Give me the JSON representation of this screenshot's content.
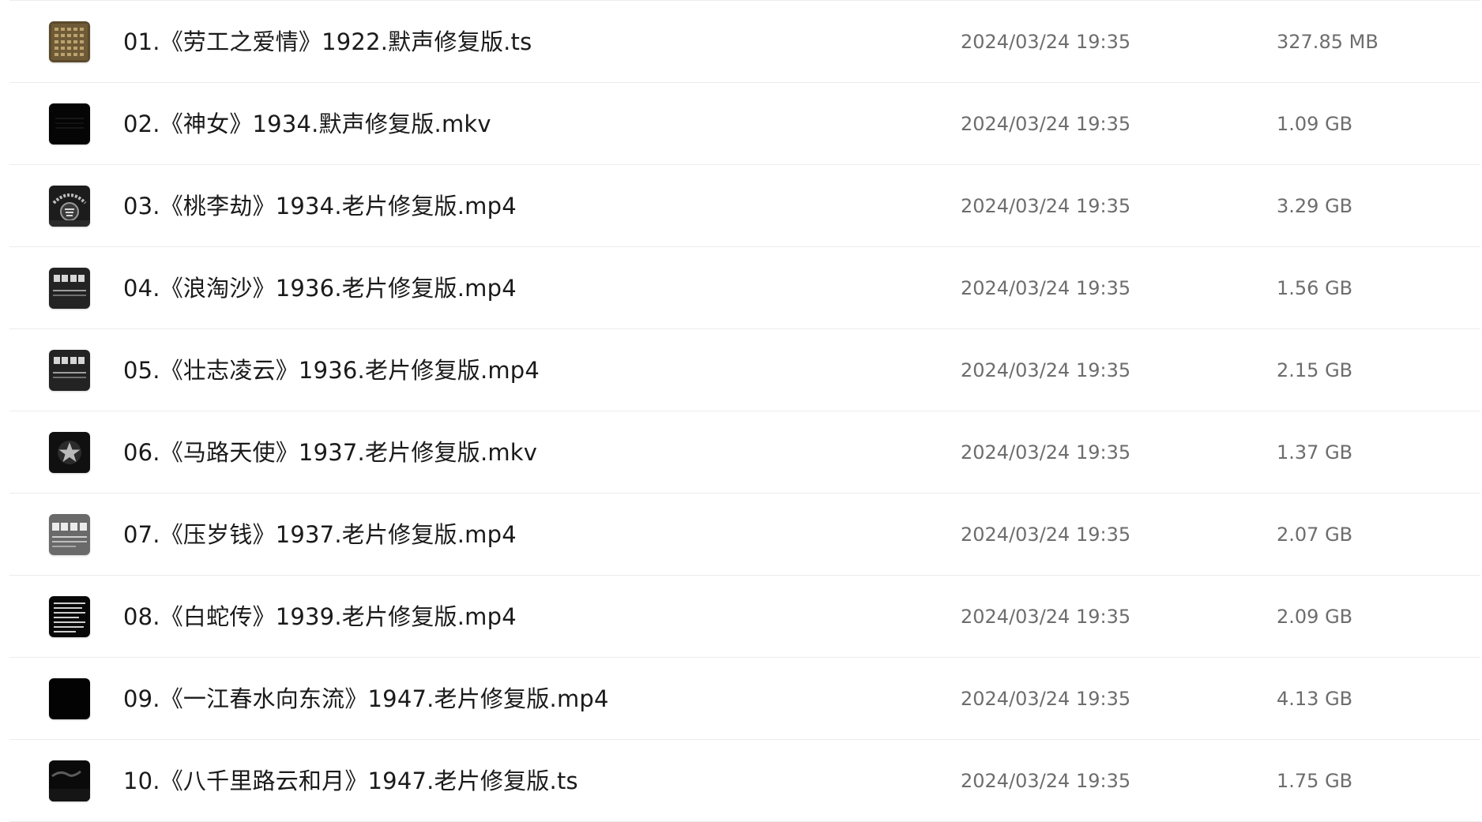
{
  "files": [
    {
      "name": "01.《劳工之爱情》1922.默声修复版.ts",
      "modified": "2024/03/24 19:35",
      "size": "327.85 MB",
      "thumbnail": "video-thumbnail-sepia-text"
    },
    {
      "name": "02.《神女》1934.默声修复版.mkv",
      "modified": "2024/03/24 19:35",
      "size": "1.09 GB",
      "thumbnail": "video-thumbnail-dark"
    },
    {
      "name": "03.《桃李劫》1934.老片修复版.mp4",
      "modified": "2024/03/24 19:35",
      "size": "3.29 GB",
      "thumbnail": "video-thumbnail-emblem"
    },
    {
      "name": "04.《浪淘沙》1936.老片修复版.mp4",
      "modified": "2024/03/24 19:35",
      "size": "1.56 GB",
      "thumbnail": "video-thumbnail-archive-card"
    },
    {
      "name": "05.《壮志凌云》1936.老片修复版.mp4",
      "modified": "2024/03/24 19:35",
      "size": "2.15 GB",
      "thumbnail": "video-thumbnail-archive-card"
    },
    {
      "name": "06.《马路天使》1937.老片修复版.mkv",
      "modified": "2024/03/24 19:35",
      "size": "1.37 GB",
      "thumbnail": "video-thumbnail-star"
    },
    {
      "name": "07.《压岁钱》1937.老片修复版.mp4",
      "modified": "2024/03/24 19:35",
      "size": "2.07 GB",
      "thumbnail": "video-thumbnail-archive-card-grey"
    },
    {
      "name": "08.《白蛇传》1939.老片修复版.mp4",
      "modified": "2024/03/24 19:35",
      "size": "2.09 GB",
      "thumbnail": "video-thumbnail-text-screen"
    },
    {
      "name": "09.《一江春水向东流》1947.老片修复版.mp4",
      "modified": "2024/03/24 19:35",
      "size": "4.13 GB",
      "thumbnail": "video-thumbnail-dark"
    },
    {
      "name": "10.《八千里路云和月》1947.老片修复版.ts",
      "modified": "2024/03/24 19:35",
      "size": "1.75 GB",
      "thumbnail": "video-thumbnail-dark-scene"
    }
  ],
  "colors": {
    "name_text": "#1a1a1a",
    "meta_text": "#6d6d6d",
    "divider": "#ececec",
    "background": "#ffffff"
  }
}
